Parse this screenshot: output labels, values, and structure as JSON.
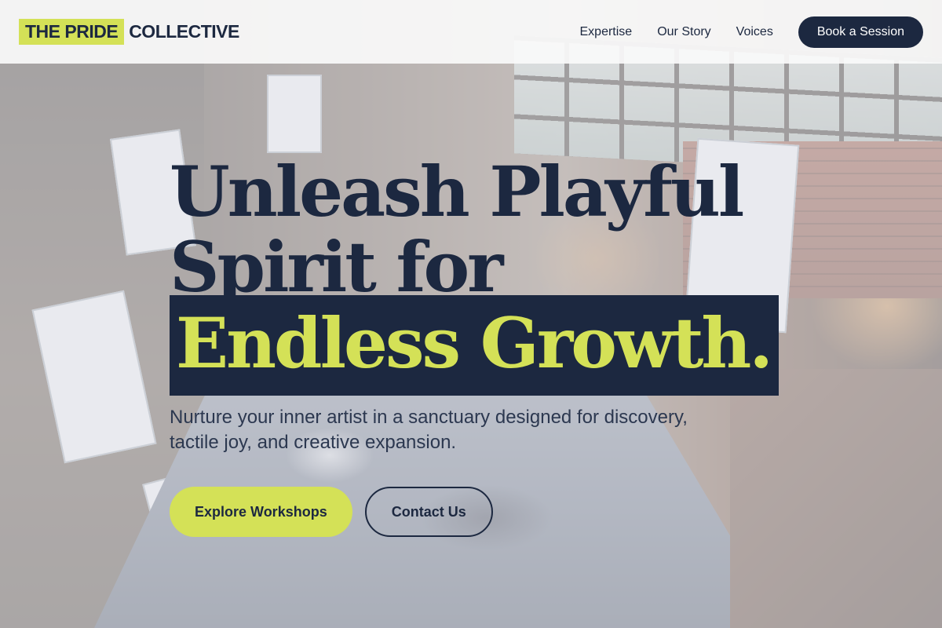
{
  "header": {
    "logo_highlight": "THE PRIDE",
    "logo_rest": "COLLECTIVE",
    "nav": [
      {
        "label": "Expertise"
      },
      {
        "label": "Our Story"
      },
      {
        "label": "Voices"
      }
    ],
    "cta_label": "Book a Session"
  },
  "hero": {
    "headline_line1": "Unleash Playful",
    "headline_line2": "Spirit for",
    "headline_highlight": "Endless Growth.",
    "subtitle": "Nurture your inner artist in a sanctuary designed for discovery, tactile joy, and creative expansion.",
    "primary_cta": "Explore Workshops",
    "secondary_cta": "Contact Us"
  },
  "colors": {
    "navy": "#1c2840",
    "lime": "#d4e157",
    "header_bg": "#fafafa"
  }
}
